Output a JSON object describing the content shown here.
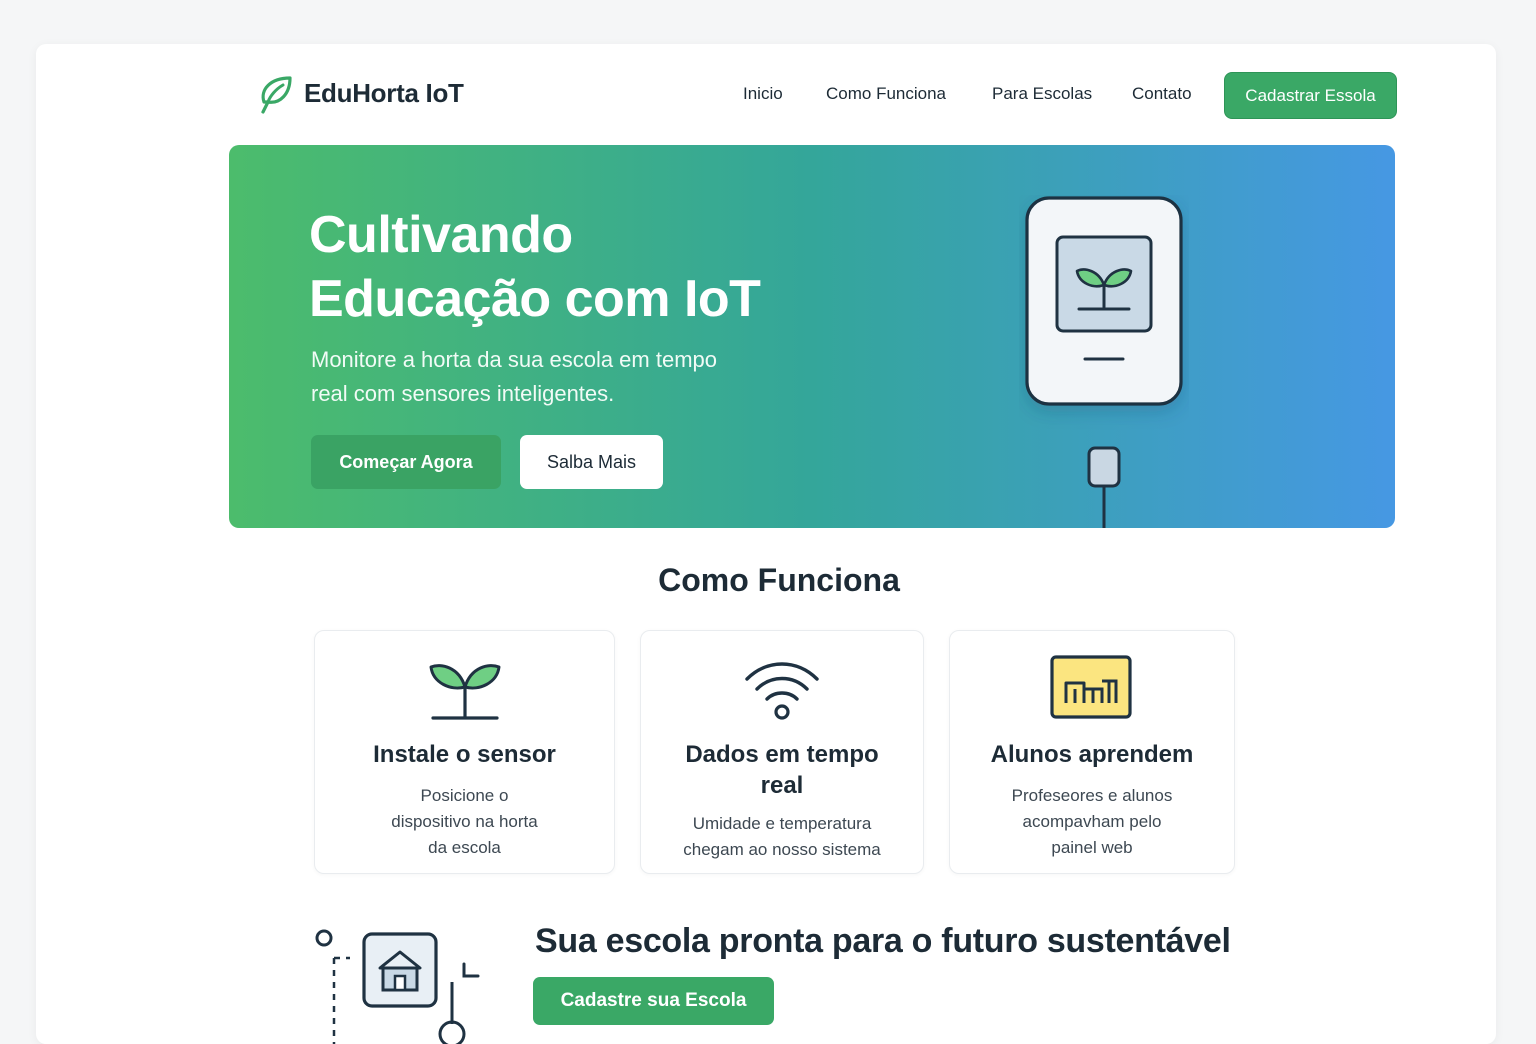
{
  "header": {
    "logo_text": "EduHorta IoT",
    "nav": [
      "Inicio",
      "Como Funciona",
      "Para Escolas",
      "Contato"
    ],
    "cta": "Cadastrar Essola"
  },
  "hero": {
    "title_line1": "Cultivando",
    "title_line2": "Educação com IoT",
    "subtitle": "Monitore a horta da sua escola em tempo real com sensores inteligentes.",
    "primary_button": "Começar Agora",
    "secondary_button": "Salba Mais"
  },
  "how": {
    "title": "Como Funciona",
    "cards": [
      {
        "icon": "sprout-icon",
        "title": "Instale o sensor",
        "desc": "Posicione o dispositivo na horta da escola"
      },
      {
        "icon": "wifi-icon",
        "title": "Dados em tempo real",
        "desc": "Umidade e temperatura chegam ao nosso sistema"
      },
      {
        "icon": "chart-icon",
        "title": "Alunos aprendem",
        "desc": "Profeseores e alunos acompavham pelo painel web"
      }
    ]
  },
  "bottom": {
    "title": "Sua escola pronta para o futuro sustentável",
    "button": "Cadastre sua Escola"
  },
  "colors": {
    "brand_green": "#3aa866",
    "hero_gradient_start": "#4cbc6c",
    "hero_gradient_end": "#4698e3",
    "text_dark": "#1d2b36"
  }
}
